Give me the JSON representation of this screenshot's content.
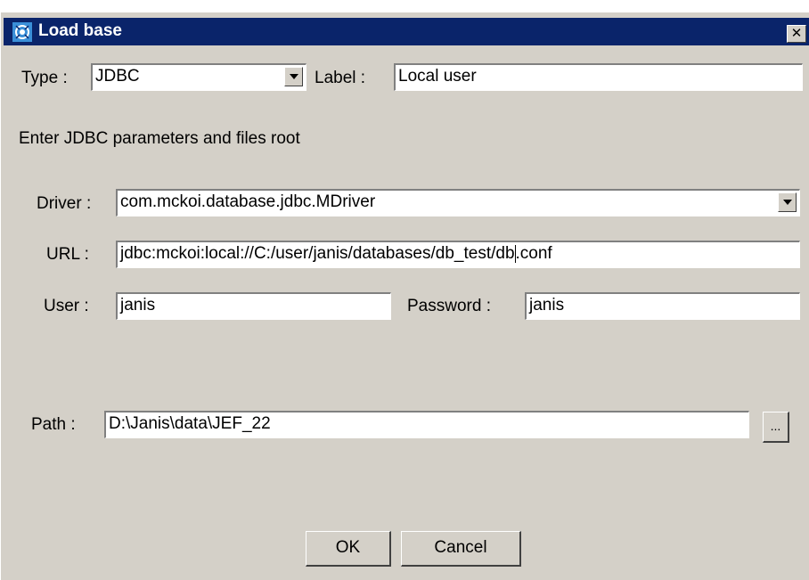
{
  "window": {
    "title": "Load base",
    "close_glyph": "✕",
    "icon": "app-icon"
  },
  "type": {
    "label": "Type :",
    "value": "JDBC"
  },
  "label_field": {
    "label": "Label :",
    "value": "Local user"
  },
  "instructions": "Enter JDBC parameters and files root",
  "driver": {
    "label": "Driver :",
    "value": "com.mckoi.database.jdbc.MDriver"
  },
  "url": {
    "label": "URL :",
    "value_before_caret": "jdbc:mckoi:local://C:/user/janis/databases/db_test/db",
    "value_after_caret": ".conf"
  },
  "user": {
    "label": "User :",
    "value": "janis"
  },
  "password": {
    "label": "Password :",
    "value": "janis"
  },
  "path": {
    "label": "Path :",
    "value": "D:\\Janis\\data\\JEF_22",
    "browse_label": "..."
  },
  "buttons": {
    "ok": "OK",
    "cancel": "Cancel"
  }
}
